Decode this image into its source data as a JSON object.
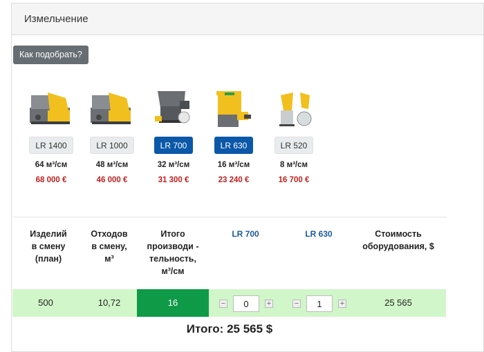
{
  "panel": {
    "title": "Измельчение"
  },
  "how_button": {
    "label": "Как подобрать?"
  },
  "machines": [
    {
      "label": "LR 1400",
      "capacity": "64 м³/см",
      "price": "68 000 €",
      "active": false,
      "variant": "yellow-wide"
    },
    {
      "label": "LR 1000",
      "capacity": "48 м³/см",
      "price": "46 000 €",
      "active": false,
      "variant": "yellow-wide"
    },
    {
      "label": "LR 700",
      "capacity": "32 м³/см",
      "price": "31 300 €",
      "active": true,
      "variant": "grey-hopper"
    },
    {
      "label": "LR 630",
      "capacity": "16 м³/см",
      "price": "23 240 €",
      "active": true,
      "variant": "yellow-box"
    },
    {
      "label": "LR 520",
      "capacity": "8 м³/см",
      "price": "16 700 €",
      "active": false,
      "variant": "yellow-small"
    }
  ],
  "table": {
    "headers": {
      "items": "Изделий\nв смену\n(план)",
      "waste": "Отходов\nв смену,\nм³",
      "total_perf": "Итого\nпроизводи -\nтельность,\nм³/см",
      "model_a": "LR 700",
      "model_b": "LR 630",
      "cost": "Стоимость\nоборудования, $"
    },
    "row": {
      "items": "500",
      "waste": "10,72",
      "total_perf": "16",
      "qty_a": "0",
      "qty_b": "1",
      "cost": "25 565"
    }
  },
  "total": {
    "text": "Итого: 25 565 $"
  },
  "colors": {
    "active_label": "#0b58a8",
    "price": "#c0201e",
    "row_bg": "#d1f6c9",
    "highlight": "#0f9a48",
    "machine_yellow": "#f2c01e",
    "machine_grey": "#6b6f73"
  }
}
